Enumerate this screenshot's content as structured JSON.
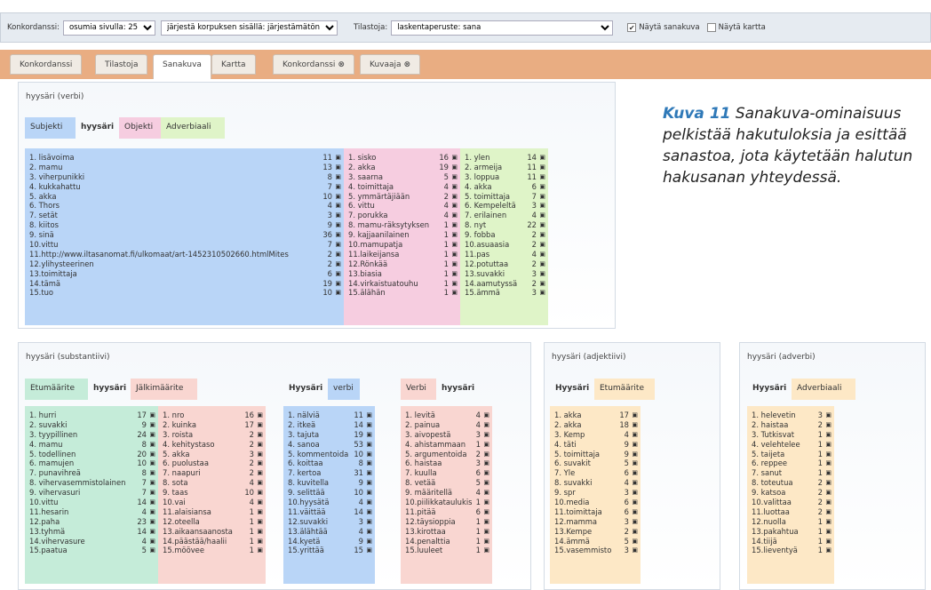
{
  "toolbar": {
    "konk_label": "Konkordanssi:",
    "konk_value": "osumia sivulla: 25",
    "sort_value": "järjestä korpuksen sisällä: järjestämätön",
    "stats_label": "Tilastoja:",
    "stats_value": "laskentaperuste: sana",
    "show_wordpic_label": "Näytä sanakuva",
    "show_wordpic_checked": true,
    "show_map_label": "Näytä kartta",
    "show_map_checked": false
  },
  "tabs": [
    {
      "label": "Konkordanssi"
    },
    {
      "label": "Tilastoja"
    },
    {
      "label": "Sanakuva",
      "active": true
    },
    {
      "label": "Kartta"
    },
    {
      "label": "Konkordanssi",
      "closable": true
    },
    {
      "label": "Kuvaaja",
      "closable": true
    }
  ],
  "icon_names": {
    "list": "document-icon",
    "close": "close-circle-icon"
  },
  "caption": {
    "bold": "Kuva 11",
    "text": "Sanakuva-ominaisuus pelkistää hakutuloksia ja esittää sanastoa, jota käytetään halutun hakusanan yhteydessä."
  },
  "verb": {
    "title": "hyysäri (verbi)",
    "headers": [
      "Subjekti",
      "hyysäri",
      "Objekti",
      "Adverbiaali"
    ],
    "subjekti": [
      [
        "1. lisävoima",
        "11"
      ],
      [
        "2. mamu",
        "13"
      ],
      [
        "3. viherpunikki",
        "8"
      ],
      [
        "4. kukkahattu",
        "7"
      ],
      [
        "5. akka",
        "10"
      ],
      [
        "6. Thors",
        "4"
      ],
      [
        "7. setät",
        "3"
      ],
      [
        "8. kiitos",
        "9"
      ],
      [
        "9. sinä",
        "36"
      ],
      [
        "10.vittu",
        "7"
      ],
      [
        "11.http://www.iltasanomat.fi/ulkomaat/art-1452310502660.htmlMites",
        "2"
      ],
      [
        "12.ylihysteerinen",
        "2"
      ],
      [
        "13.toimittaja",
        "6"
      ],
      [
        "14.tämä",
        "19"
      ],
      [
        "15.tuo",
        "10"
      ]
    ],
    "objekti": [
      [
        "1. sisko",
        "16"
      ],
      [
        "2. akka",
        "19"
      ],
      [
        "3. saarna",
        "5"
      ],
      [
        "4. toimittaja",
        "4"
      ],
      [
        "5. ymmärtäjiään",
        "2"
      ],
      [
        "6. vittu",
        "4"
      ],
      [
        "7. porukka",
        "4"
      ],
      [
        "8. mamu-räksytyksen",
        "1"
      ],
      [
        "9. kajjaanilainen",
        "1"
      ],
      [
        "10.mamupatja",
        "1"
      ],
      [
        "11.laikeijansa",
        "1"
      ],
      [
        "12.Rönkää",
        "1"
      ],
      [
        "13.biasia",
        "1"
      ],
      [
        "14.virkaistuatouhu",
        "1"
      ],
      [
        "15.älähän",
        "1"
      ]
    ],
    "adverbiaali": [
      [
        "1. ylen",
        "14"
      ],
      [
        "2. armeija",
        "11"
      ],
      [
        "3. loppua",
        "11"
      ],
      [
        "4. akka",
        "6"
      ],
      [
        "5. toimittaja",
        "7"
      ],
      [
        "6. Kempeleltä",
        "3"
      ],
      [
        "7. erilainen",
        "4"
      ],
      [
        "8. nyt",
        "22"
      ],
      [
        "9. fobba",
        "2"
      ],
      [
        "10.asuaasia",
        "2"
      ],
      [
        "11.pas",
        "4"
      ],
      [
        "12.potuttaa",
        "2"
      ],
      [
        "13.suvakki",
        "3"
      ],
      [
        "14.aamutyssä",
        "2"
      ],
      [
        "15.ämmä",
        "3"
      ]
    ]
  },
  "noun": {
    "title": "hyysäri (substantiivi)",
    "headers1": [
      "Etumäärite",
      "hyysäri",
      "Jälkimäärite"
    ],
    "headers2": [
      "Hyysäri",
      "verbi"
    ],
    "headers3": [
      "Verbi",
      "hyysäri"
    ],
    "etumaarite": [
      [
        "1. hurri",
        "17"
      ],
      [
        "2. suvakki",
        "9"
      ],
      [
        "3. tyypillinen",
        "24"
      ],
      [
        "4. mamu",
        "8"
      ],
      [
        "5. todellinen",
        "20"
      ],
      [
        "6. mamujen",
        "10"
      ],
      [
        "7. punavihreä",
        "8"
      ],
      [
        "8. vihervasemmistolainen",
        "7"
      ],
      [
        "9. vihervasuri",
        "7"
      ],
      [
        "10.vittu",
        "14"
      ],
      [
        "11.hesarin",
        "4"
      ],
      [
        "12.paha",
        "23"
      ],
      [
        "13.tyhmä",
        "14"
      ],
      [
        "14.vihervasure",
        "4"
      ],
      [
        "15.paatua",
        "5"
      ]
    ],
    "jalkimaarite": [
      [
        "1. nro",
        "16"
      ],
      [
        "2. kuinka",
        "17"
      ],
      [
        "3. roista",
        "2"
      ],
      [
        "4. kehitystaso",
        "2"
      ],
      [
        "5. akka",
        "3"
      ],
      [
        "6. puolustaa",
        "2"
      ],
      [
        "7. naapuri",
        "2"
      ],
      [
        "8. sota",
        "4"
      ],
      [
        "9. taas",
        "10"
      ],
      [
        "10.vai",
        "4"
      ],
      [
        "11.alaisiansa",
        "1"
      ],
      [
        "12.oteella",
        "1"
      ],
      [
        "13.aikaansaanosta",
        "1"
      ],
      [
        "14.päästää/haalii",
        "1"
      ],
      [
        "15.möövee",
        "1"
      ]
    ],
    "verbi": [
      [
        "1. nälviä",
        "11"
      ],
      [
        "2. itkeä",
        "14"
      ],
      [
        "3. tajuta",
        "19"
      ],
      [
        "4. sanoa",
        "53"
      ],
      [
        "5. kommentoida",
        "10"
      ],
      [
        "6. koittaa",
        "8"
      ],
      [
        "7. kertoa",
        "31"
      ],
      [
        "8. kuvitella",
        "9"
      ],
      [
        "9. selittää",
        "10"
      ],
      [
        "10.hyysätä",
        "4"
      ],
      [
        "11.väittää",
        "14"
      ],
      [
        "12.suvakki",
        "3"
      ],
      [
        "13.älähtää",
        "4"
      ],
      [
        "14.kyetä",
        "9"
      ],
      [
        "15.yrittää",
        "15"
      ]
    ],
    "verbi2": [
      [
        "1. levitä",
        "4"
      ],
      [
        "2. painua",
        "4"
      ],
      [
        "3. aivopestä",
        "3"
      ],
      [
        "4. ahistammaan",
        "1"
      ],
      [
        "5. argumentoida",
        "2"
      ],
      [
        "6. haistaa",
        "3"
      ],
      [
        "7. kuulla",
        "6"
      ],
      [
        "8. vetää",
        "5"
      ],
      [
        "9. määritellä",
        "4"
      ],
      [
        "10.piilikkataulukisi",
        "1"
      ],
      [
        "11.pitää",
        "6"
      ],
      [
        "12.täysioppia",
        "1"
      ],
      [
        "13.kirottaa",
        "1"
      ],
      [
        "14.penalttia",
        "1"
      ],
      [
        "15.luuleet",
        "1"
      ]
    ]
  },
  "adj": {
    "title": "hyysäri (adjektiivi)",
    "headers": [
      "Hyysäri",
      "Etumäärite"
    ],
    "items": [
      [
        "1. akka",
        "17"
      ],
      [
        "2. akka",
        "18"
      ],
      [
        "3. Kemp",
        "4"
      ],
      [
        "4. täti",
        "9"
      ],
      [
        "5. toimittaja",
        "9"
      ],
      [
        "6. suvakit",
        "5"
      ],
      [
        "7. Yle",
        "6"
      ],
      [
        "8. suvakki",
        "4"
      ],
      [
        "9. spr",
        "3"
      ],
      [
        "10.media",
        "6"
      ],
      [
        "11.toimittaja",
        "6"
      ],
      [
        "12.mamma",
        "3"
      ],
      [
        "13.Kempe",
        "2"
      ],
      [
        "14.ämmä",
        "5"
      ],
      [
        "15.vasemmisto",
        "3"
      ]
    ]
  },
  "adv": {
    "title": "hyysäri (adverbi)",
    "headers": [
      "Hyysäri",
      "Adverbiaali"
    ],
    "items": [
      [
        "1. helevetin",
        "3"
      ],
      [
        "2. haistaa",
        "2"
      ],
      [
        "3. Tutkisvat",
        "1"
      ],
      [
        "4. velehtelee",
        "1"
      ],
      [
        "5. taijeta",
        "1"
      ],
      [
        "6. reppee",
        "1"
      ],
      [
        "7. sanut",
        "1"
      ],
      [
        "8. toteutua",
        "2"
      ],
      [
        "9. katsoa",
        "2"
      ],
      [
        "10.valittaa",
        "2"
      ],
      [
        "11.luottaa",
        "2"
      ],
      [
        "12.nuolla",
        "1"
      ],
      [
        "13.pakahtua",
        "1"
      ],
      [
        "14.tiijä",
        "1"
      ],
      [
        "15.lieventyä",
        "1"
      ]
    ]
  }
}
